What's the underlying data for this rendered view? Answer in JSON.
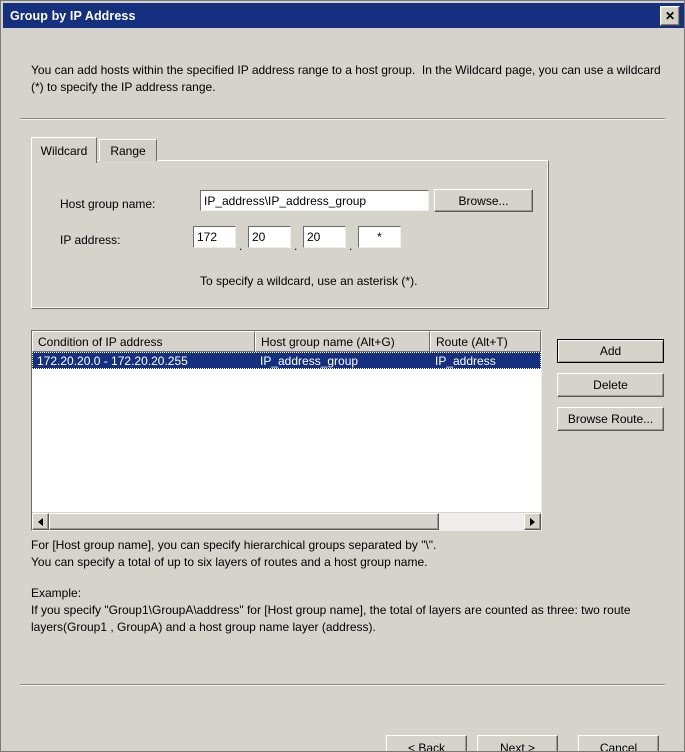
{
  "window": {
    "title": "Group by IP Address",
    "close_icon": "close-icon",
    "close_glyph": "✕"
  },
  "intro": {
    "text": "You can add hosts within the specified IP address range to a host group.  In the Wildcard page, you can use a wildcard (*) to specify the IP address range."
  },
  "tabs": [
    {
      "label": "Wildcard",
      "active": true
    },
    {
      "label": "Range",
      "active": false
    }
  ],
  "wildcard_page": {
    "host_group_label": "Host group name:",
    "host_group_value": "IP_address\\IP_address_group",
    "host_group_placeholder": "",
    "browse_button": "Browse...",
    "ip_label": "IP address:",
    "ip_octets": [
      "172",
      "20",
      "20",
      "*"
    ],
    "separator": ".",
    "hint": "To specify a wildcard, use an asterisk (*)."
  },
  "list": {
    "columns": [
      "Condition of IP address",
      "Host group name (Alt+G)",
      "Route (Alt+T)"
    ],
    "rows": [
      {
        "condition": "172.20.20.0 - 172.20.20.255",
        "host_group_name": "IP_address_group",
        "route": "IP_address",
        "selected": true
      }
    ],
    "scroll_left_icon": "arrow-left-icon",
    "scroll_right_icon": "arrow-right-icon"
  },
  "actions": {
    "add": "Add",
    "delete": "Delete",
    "browse_route": "Browse Route..."
  },
  "help": {
    "line_1": "For [Host group name], you can specify hierarchical groups separated by \"\\\".\nYou can specify a total of up to six layers of routes and a host group name.",
    "line_2": "Example:\nIf you specify \"Group1\\GroupA\\address\" for [Host group name], the total of layers are counted as three: two route layers(Group1 , GroupA) and a host group name layer (address)."
  },
  "footer": {
    "back": "< Back",
    "next": "Next >",
    "cancel": "Cancel"
  },
  "colors": {
    "titlebar": "#14307e",
    "selection": "#14307e",
    "dialog_face": "#d6d3cd",
    "field_bg": "#ffffff"
  }
}
